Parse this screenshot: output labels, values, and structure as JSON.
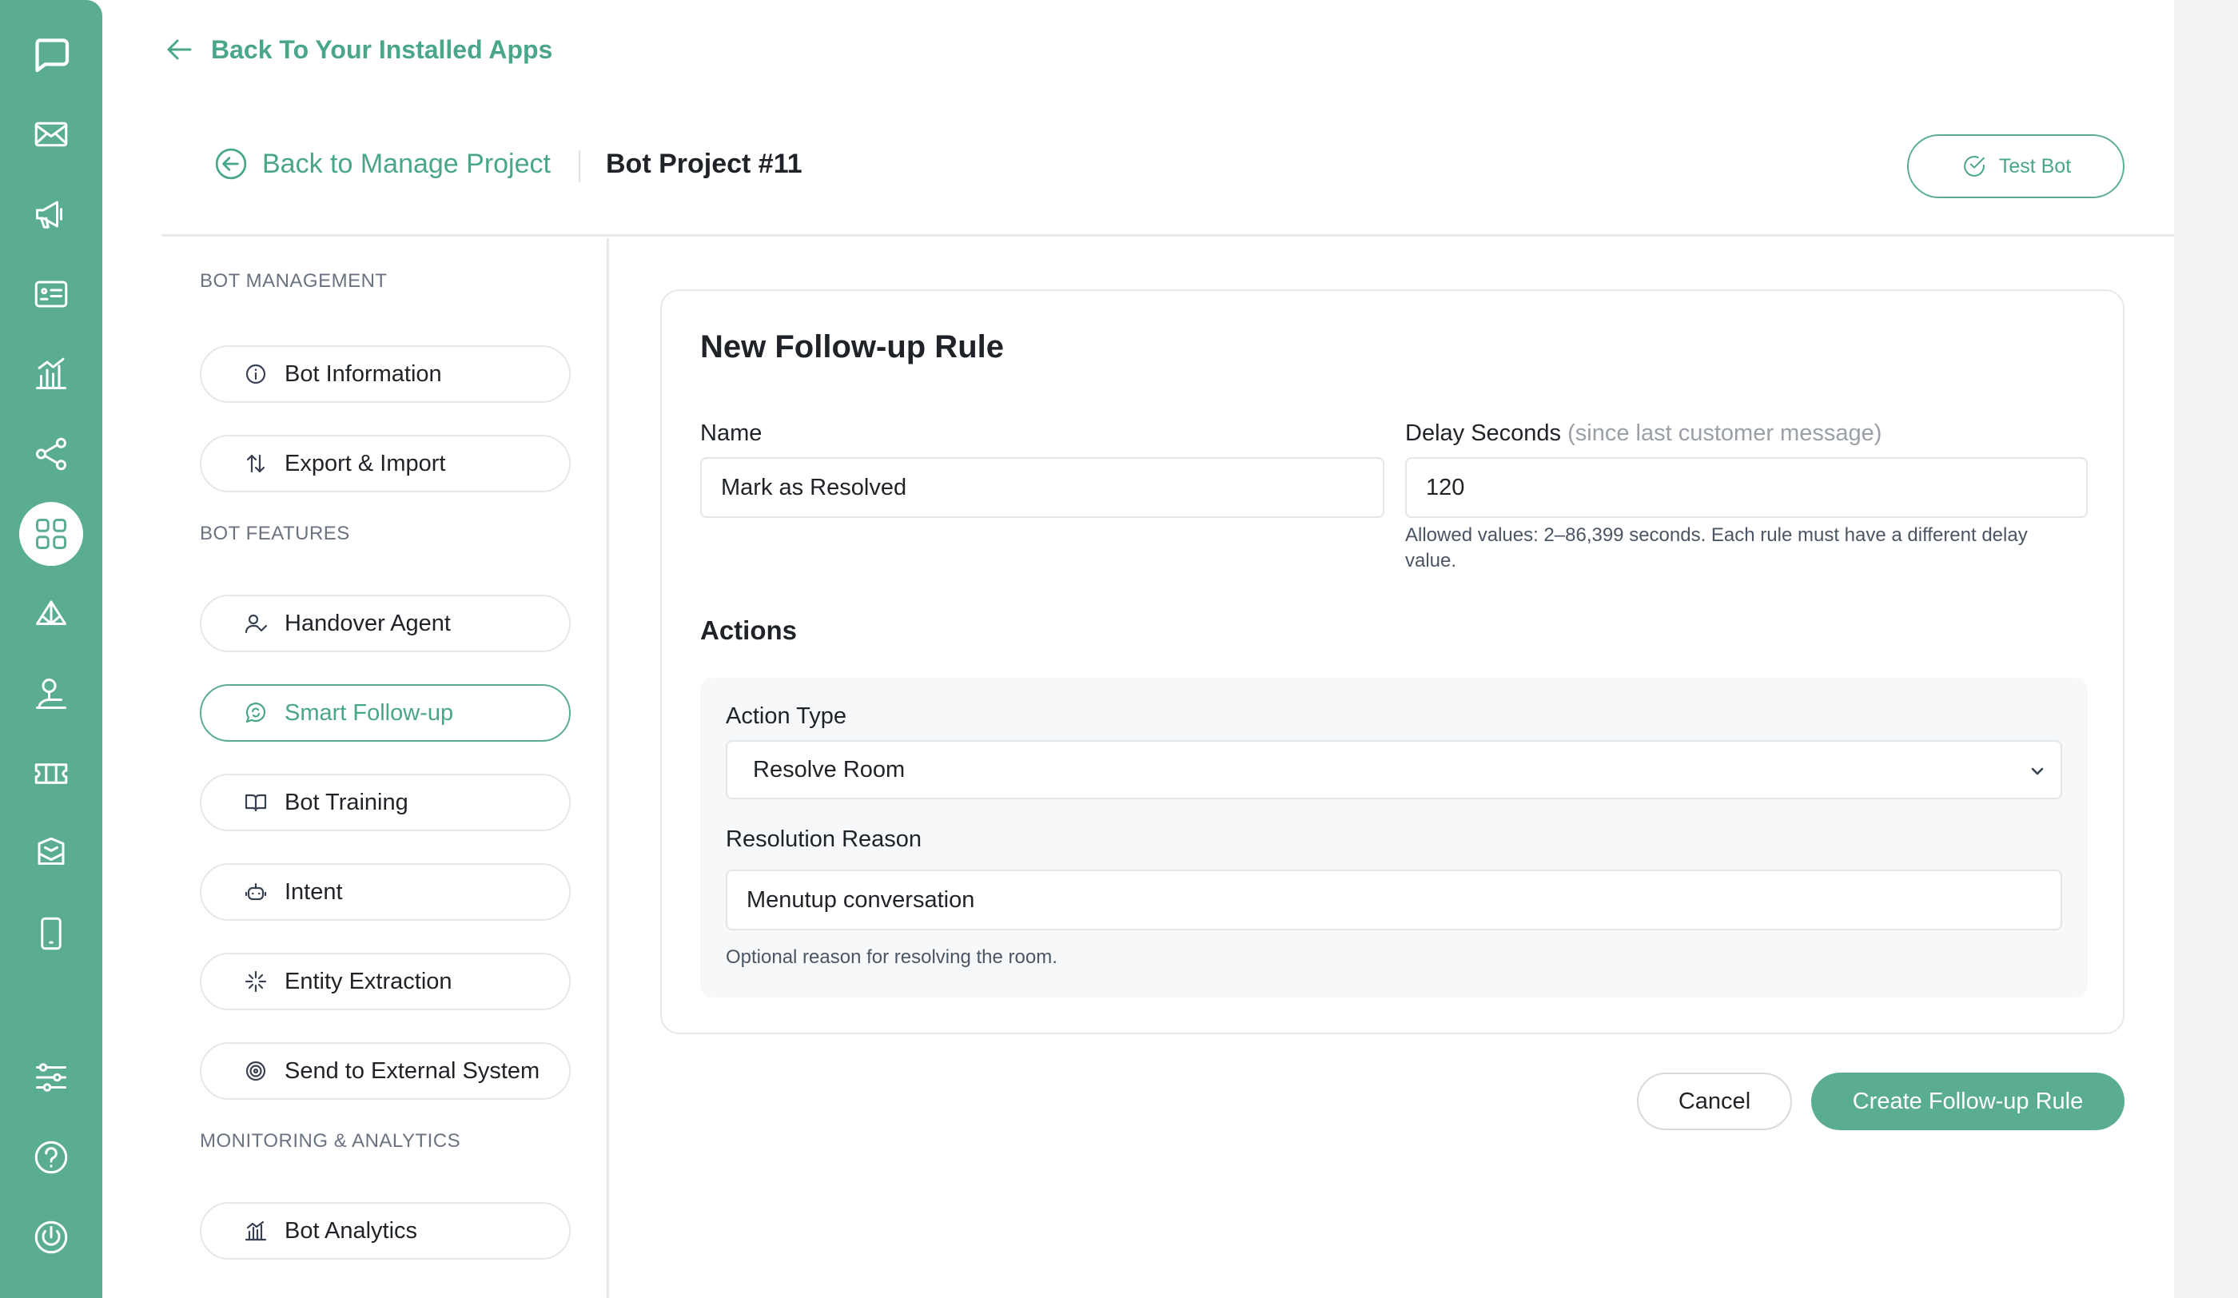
{
  "top_back": {
    "label": "Back To Your Installed Apps"
  },
  "header": {
    "back_manage_label": "Back to Manage Project",
    "project_title": "Bot Project #11",
    "test_bot_label": "Test Bot"
  },
  "rail": {
    "icons": [
      "chat-icon",
      "mail-icon",
      "megaphone-icon",
      "contact-card-icon",
      "analytics-icon",
      "share-icon",
      "apps-grid-icon",
      "integration-icon",
      "agent-icon",
      "ticket-icon",
      "inbox-icon",
      "mobile-icon",
      "settings-sliders-icon",
      "help-icon",
      "power-icon"
    ],
    "active": "apps-grid-icon"
  },
  "sidebar": {
    "sections": [
      {
        "title": "BOT MANAGEMENT",
        "items": [
          {
            "label": "Bot Information",
            "icon": "info-icon"
          },
          {
            "label": "Export & Import",
            "icon": "swap-vertical-icon"
          }
        ]
      },
      {
        "title": "BOT FEATURES",
        "items": [
          {
            "label": "Handover Agent",
            "icon": "user-check-icon"
          },
          {
            "label": "Smart Follow-up",
            "icon": "chat-refresh-icon",
            "active": true
          },
          {
            "label": "Bot Training",
            "icon": "book-icon"
          },
          {
            "label": "Intent",
            "icon": "robot-icon"
          },
          {
            "label": "Entity Extraction",
            "icon": "sparkle-icon"
          },
          {
            "label": "Send to External System",
            "icon": "target-icon"
          }
        ]
      },
      {
        "title": "MONITORING & ANALYTICS",
        "items": [
          {
            "label": "Bot Analytics",
            "icon": "bar-chart-icon"
          }
        ]
      }
    ]
  },
  "form": {
    "title": "New Follow-up Rule",
    "name_label": "Name",
    "name_value": "Mark as Resolved",
    "delay_label": "Delay Seconds",
    "delay_hint": "(since last customer message)",
    "delay_value": "120",
    "delay_help_line1": "Allowed values: 2–86,399 seconds. Each rule must have a different delay",
    "delay_help_line2": "value.",
    "actions_title": "Actions",
    "action_type_label": "Action Type",
    "action_type_value": "Resolve Room",
    "resolution_label": "Resolution Reason",
    "resolution_value": "Menutup conversation",
    "resolution_help": "Optional reason for resolving the room."
  },
  "buttons": {
    "cancel": "Cancel",
    "create": "Create Follow-up Rule"
  },
  "colors": {
    "accent": "#5aad93",
    "accent_text": "#4aa68b",
    "border": "#e7e9ec"
  }
}
